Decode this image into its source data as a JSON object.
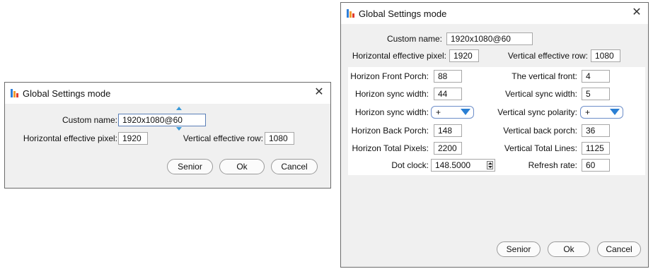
{
  "small_dialog": {
    "title": "Global Settings mode",
    "close_glyph": "✕",
    "custom_name_label": "Custom name:",
    "custom_name_value": "1920x1080@60",
    "h_pixel_label": "Horizontal effective pixel:",
    "h_pixel_value": "1920",
    "v_row_label": "Vertical effective row:",
    "v_row_value": "1080",
    "buttons": {
      "senior": "Senior",
      "ok": "Ok",
      "cancel": "Cancel"
    }
  },
  "large_dialog": {
    "title": "Global Settings mode",
    "close_glyph": "✕",
    "custom_name_label": "Custom name:",
    "custom_name_value": "1920x1080@60",
    "h_pixel_label": "Horizontal effective pixel:",
    "h_pixel_value": "1920",
    "v_row_label": "Vertical effective row:",
    "v_row_value": "1080",
    "left": {
      "front_porch_label": "Horizon Front Porch:",
      "front_porch_value": "88",
      "sync_width_label": "Horizon sync width:",
      "sync_width_value": "44",
      "sync_polarity_label": "Horizon sync width:",
      "sync_polarity_value": "+",
      "back_porch_label": "Horizon Back Porch:",
      "back_porch_value": "148",
      "total_pixels_label": "Horizon Total Pixels:",
      "total_pixels_value": "2200",
      "dot_clock_label": "Dot clock:",
      "dot_clock_value": "148.5000"
    },
    "right": {
      "front_label": "The vertical front:",
      "front_value": "4",
      "sync_width_label": "Vertical sync width:",
      "sync_width_value": "5",
      "sync_polarity_label": "Vertical sync polarity:",
      "sync_polarity_value": "+",
      "back_porch_label": "Vertical back porch:",
      "back_porch_value": "36",
      "total_lines_label": "Vertical Total Lines:",
      "total_lines_value": "1125",
      "refresh_label": "Refresh rate:",
      "refresh_value": "60"
    },
    "buttons": {
      "senior": "Senior",
      "ok": "Ok",
      "cancel": "Cancel"
    }
  },
  "colors": {
    "accent": "#2a7fd4",
    "dialog_bg": "#f0f0f0",
    "icon_red": "#e03a2e",
    "icon_orange": "#f29a2e",
    "icon_blue": "#2f7fd8"
  }
}
